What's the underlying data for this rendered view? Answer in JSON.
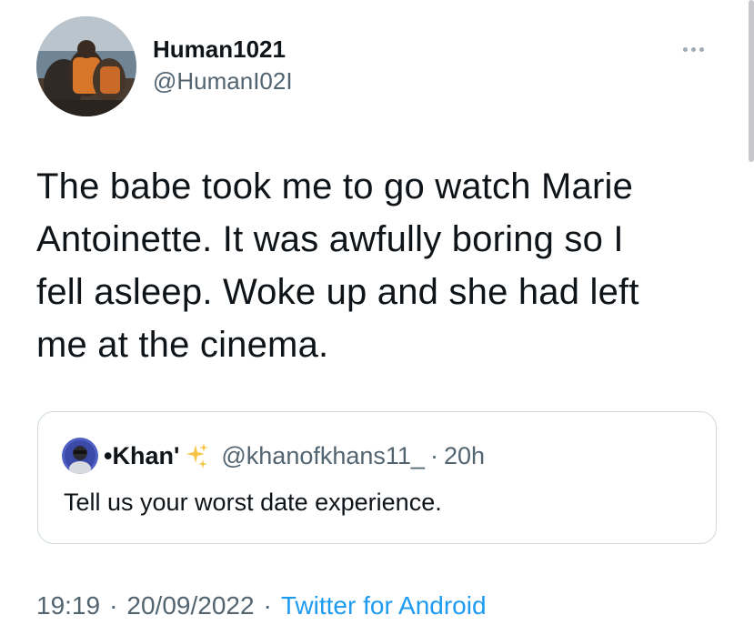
{
  "author": {
    "display_name": "Human1021",
    "handle": "@HumanI02I"
  },
  "tweet": {
    "text": "The babe took me to go watch Marie\nAntoinette. It was awfully boring so I\nfell asleep. Woke up and she had left\nme at the cinema."
  },
  "quoted_tweet": {
    "display_name": "•Khan'",
    "name_emoji": "sparkles-icon",
    "handle": "@khanofkhans11_",
    "separator": "·",
    "time": "20h",
    "text": "Tell us your worst date experience."
  },
  "meta": {
    "time": "19:19",
    "separator_1": "·",
    "date": "20/09/2022",
    "separator_2": "·",
    "source": "Twitter for Android"
  },
  "colors": {
    "text_primary": "#0f1419",
    "text_secondary": "#536471",
    "link": "#1d9bf0",
    "border": "#cfd9de"
  }
}
